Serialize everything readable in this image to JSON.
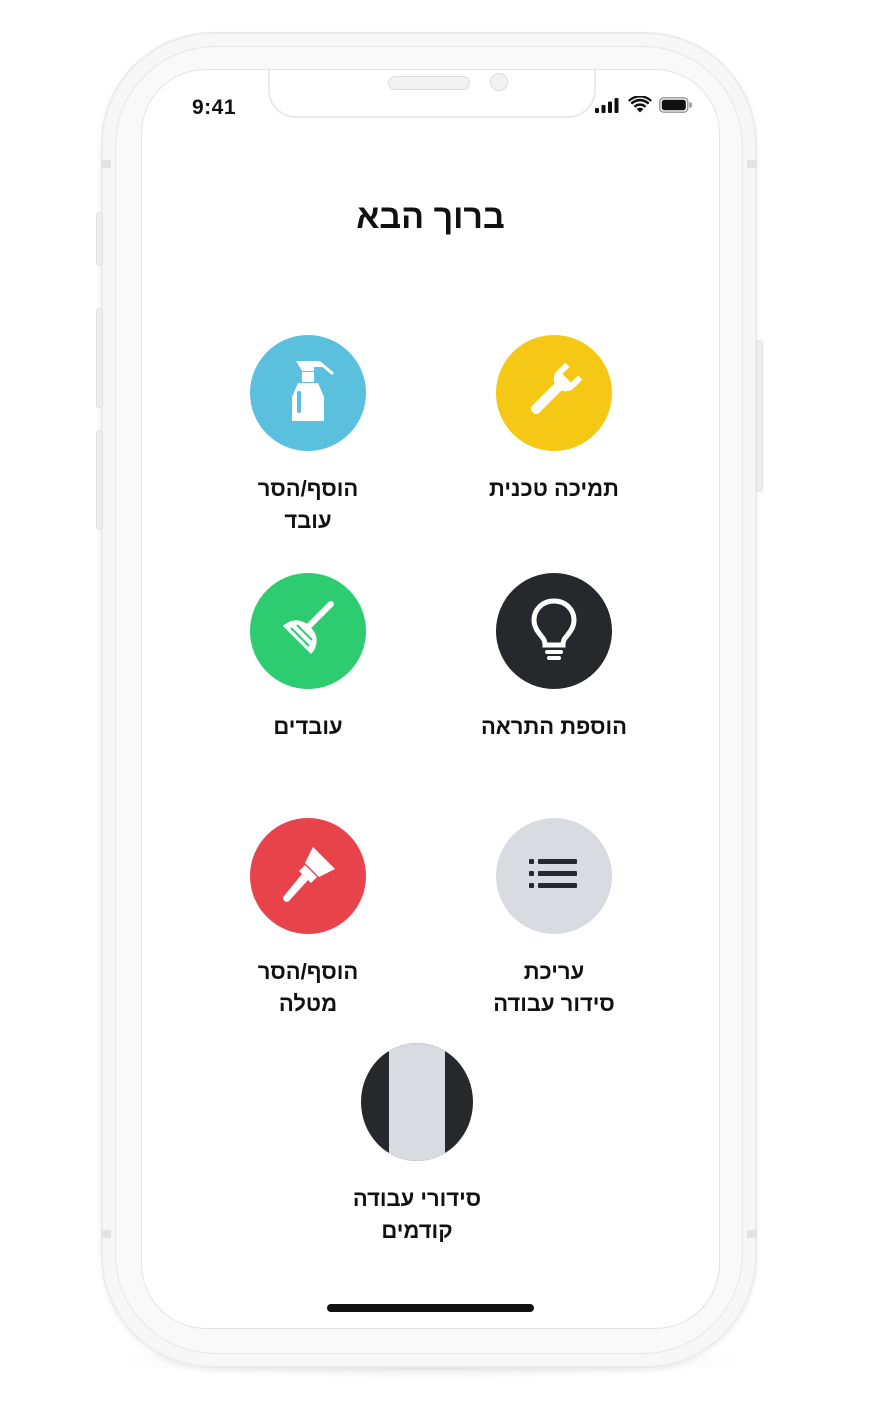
{
  "status_bar": {
    "time": "9:41",
    "icons": [
      "cellular-signal-icon",
      "wifi-icon",
      "battery-icon"
    ]
  },
  "header": {
    "title": "ברוך הבא"
  },
  "menu": {
    "items": [
      {
        "id": "tech-support",
        "label": "תמיכה טכנית",
        "icon": "wrench-icon",
        "color": "#F5C816"
      },
      {
        "id": "add-remove-worker",
        "label": "הוסף/הסר\nעובד",
        "icon": "spray-bottle-icon",
        "color": "#5BC0DE"
      },
      {
        "id": "add-alert",
        "label": "הוספת התראה",
        "icon": "lightbulb-icon",
        "color": "#27282C"
      },
      {
        "id": "workers",
        "label": "עובדים",
        "icon": "plunger-icon",
        "color": "#2ECC71"
      },
      {
        "id": "edit-schedule",
        "label": "עריכת\nסידור עבודה",
        "icon": "list-icon",
        "color": "#D8DCE1"
      },
      {
        "id": "add-remove-task",
        "label": "הוסף/הסר\nמטלה",
        "icon": "paint-brush-icon",
        "color": "#E8434B"
      },
      {
        "id": "previous-schedules",
        "label": "סידורי עבודה\nקודמים",
        "icon": "striped-calendar-icon",
        "color": "#27282C"
      }
    ]
  },
  "colors": {
    "background": "#FFFFFF",
    "text": "#111111",
    "phone_frame": "#F7F7F7"
  }
}
